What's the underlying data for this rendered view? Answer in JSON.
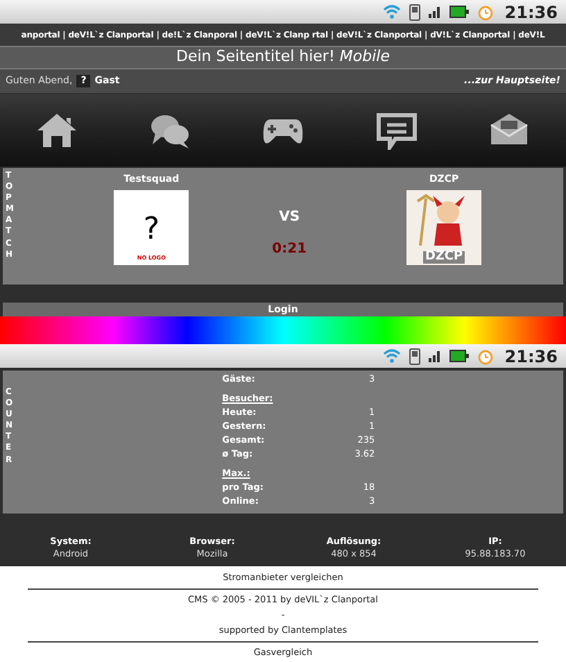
{
  "status_bar_top": {
    "time": "21:36"
  },
  "ticker": "anportal | deV!L`z Clanportal | de!L`z Clanporal | deV!L`z Clanp rtal | deV!L`z Clanportal | dV!L`z Clanportal | deV!L",
  "title": "Dein Seitentitel hier! *Mobile*",
  "greeting": {
    "text": "Guten Abend,",
    "avatar": "?",
    "user": "Gast",
    "home_link": "...zur Hauptseite!"
  },
  "nav": [
    {
      "kind": "home"
    },
    {
      "kind": "chat"
    },
    {
      "kind": "games"
    },
    {
      "kind": "comments"
    },
    {
      "kind": "mail"
    }
  ],
  "top_match": {
    "side_label": "TOP MATCH",
    "team_1": {
      "name": "Testsquad",
      "logo_mark": "?",
      "logo_caption": "NO LOGO"
    },
    "vs": "VS",
    "score": "0:21",
    "team_2": {
      "name": "DZCP",
      "logo_caption": "DZCP"
    }
  },
  "login": "Login",
  "status_bar_bottom": {
    "time": "21:36"
  },
  "counter": {
    "side_label": "COUNTER",
    "rows": [
      {
        "kind": "row",
        "label": "Gäste:",
        "value": "3"
      },
      {
        "kind": "heading",
        "label": "Besucher:"
      },
      {
        "kind": "row",
        "label": "Heute:",
        "value": "1"
      },
      {
        "kind": "row",
        "label": "Gestern:",
        "value": "1"
      },
      {
        "kind": "row",
        "label": "Gesamt:",
        "value": "235"
      },
      {
        "kind": "row",
        "label": "ø Tag:",
        "value": "3.62"
      },
      {
        "kind": "heading",
        "label": "Max.:"
      },
      {
        "kind": "row",
        "label": "pro Tag:",
        "value": "18"
      },
      {
        "kind": "row",
        "label": "Online:",
        "value": "3"
      }
    ]
  },
  "info": [
    {
      "label": "System:",
      "value": "Android"
    },
    {
      "label": "Browser:",
      "value": "Mozilla"
    },
    {
      "label": "Auflösung:",
      "value": "480 x 854"
    },
    {
      "label": "IP:",
      "value": "95.88.183.70"
    }
  ],
  "footer": [
    {
      "text": "Stromanbieter vergleichen"
    },
    {
      "text": "CMS © 2005 - 2011 by deVIL`z Clanportal"
    },
    {
      "text": "-"
    },
    {
      "text": "supported by Clantemplates"
    },
    {
      "text": "Gasvergleich"
    }
  ]
}
